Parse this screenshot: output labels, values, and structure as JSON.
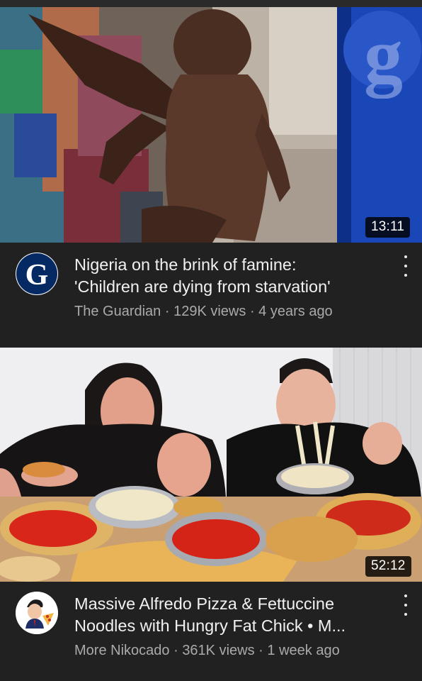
{
  "videos": [
    {
      "duration": "13:11",
      "channel_avatar_letter": "G",
      "title_line1": "Nigeria on the brink of famine:",
      "title_line2": "'Children are dying from starvation'",
      "channel": "The Guardian",
      "views": "129K views",
      "age": "4 years ago",
      "sep": "·"
    },
    {
      "duration": "52:12",
      "title_line1": "Massive Alfredo Pizza & Fettuccine",
      "title_line2": "Noodles with Hungry Fat Chick • M...",
      "channel": "More Nikocado",
      "views": "361K views",
      "age": "1 week ago",
      "sep": "·"
    }
  ],
  "colors": {
    "background": "#212121",
    "title": "#f1f1f1",
    "meta": "#aaaaaa",
    "guardian_blue": "#052962"
  },
  "icons": [
    "more-vert-icon",
    "guardian-logo-icon",
    "nikocado-avatar-icon"
  ]
}
